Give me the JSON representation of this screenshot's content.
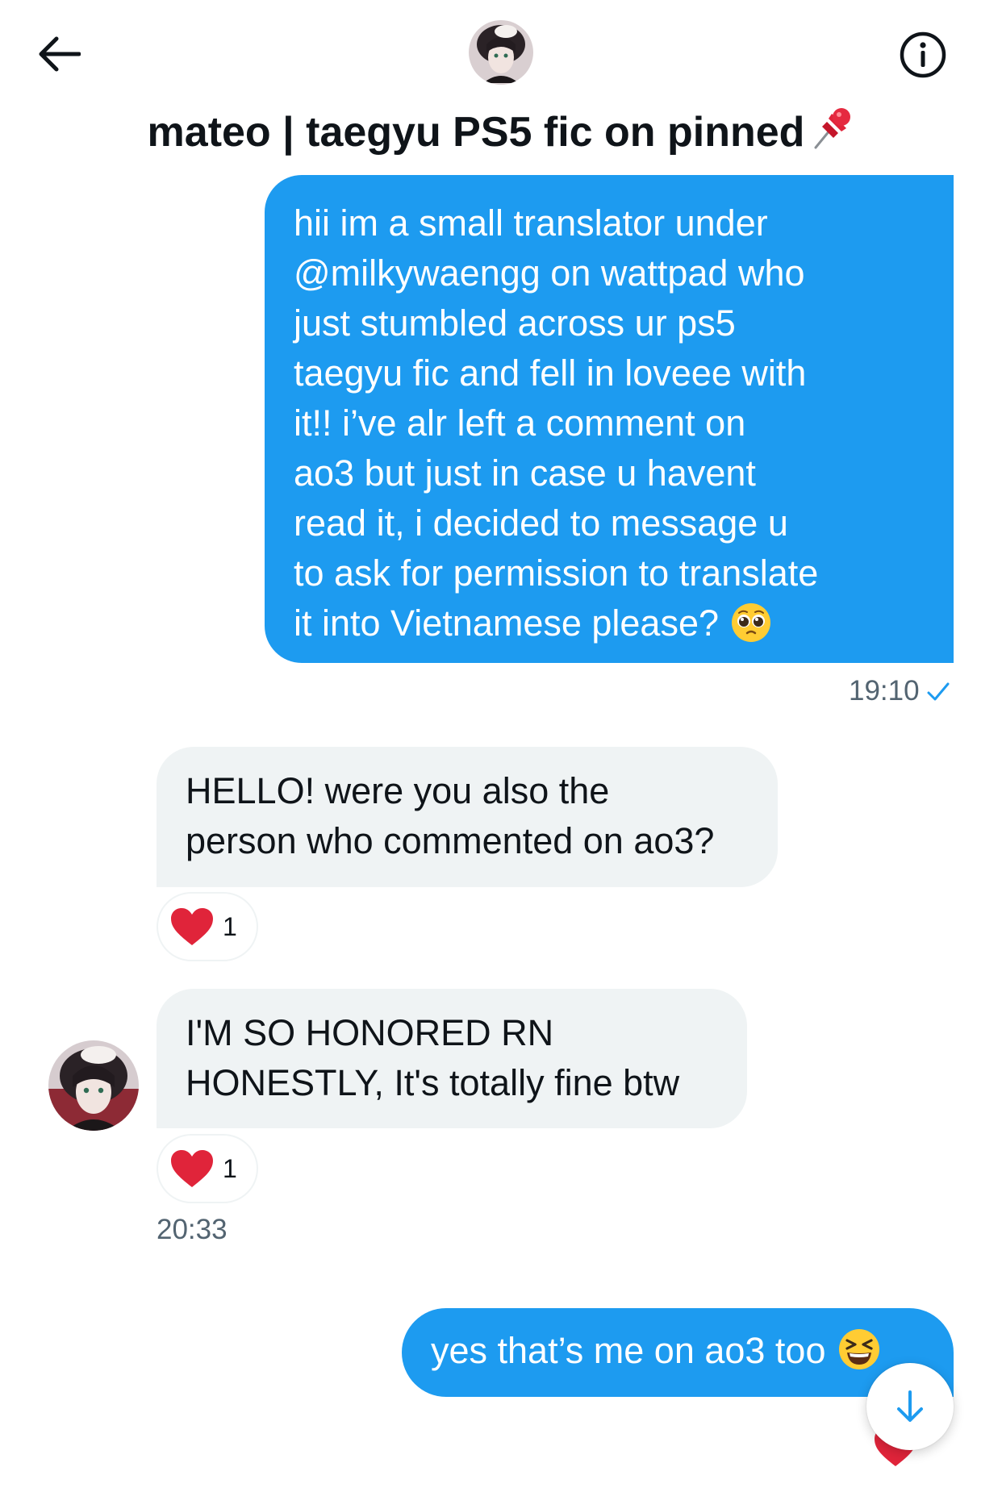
{
  "header": {
    "title": "mateo | taegyu PS5 fic on pinned",
    "title_emoji": "pushpin-icon",
    "back_icon": "back-arrow-icon",
    "info_icon": "info-icon"
  },
  "messages": [
    {
      "direction": "sent",
      "lines": [
        "hii im a small translator under",
        "@milkywaengg on wattpad who",
        "just stumbled across ur ps5",
        "taegyu fic and fell in loveee with",
        "it!! i’ve alr left a comment on",
        "ao3 but just in case u havent",
        "read it, i decided to message u",
        "to ask for permission to translate",
        "it into Vietnamese please?"
      ],
      "emoji": "pleading-face-icon",
      "timestamp": "19:10",
      "status_icon": "checkmark-icon"
    },
    {
      "direction": "received",
      "lines": [
        "HELLO! were you also the",
        "person who commented on ao3?"
      ],
      "reaction": {
        "icon": "heart-icon",
        "count": "1"
      }
    },
    {
      "direction": "received",
      "lines": [
        "I'M SO HONORED RN",
        "HONESTLY, It's totally fine btw"
      ],
      "reaction": {
        "icon": "heart-icon",
        "count": "1"
      },
      "timestamp": "20:33"
    },
    {
      "direction": "sent",
      "text": "yes that’s me on ao3 too",
      "emoji": "grinning-squinting-face-icon"
    }
  ],
  "scroll_button": {
    "icon": "arrow-down-icon"
  },
  "colors": {
    "accent": "#1d9bf0",
    "received_bubble": "#eff3f4",
    "text": "#0f1419",
    "secondary_text": "#536471",
    "heart": "#f91880"
  }
}
